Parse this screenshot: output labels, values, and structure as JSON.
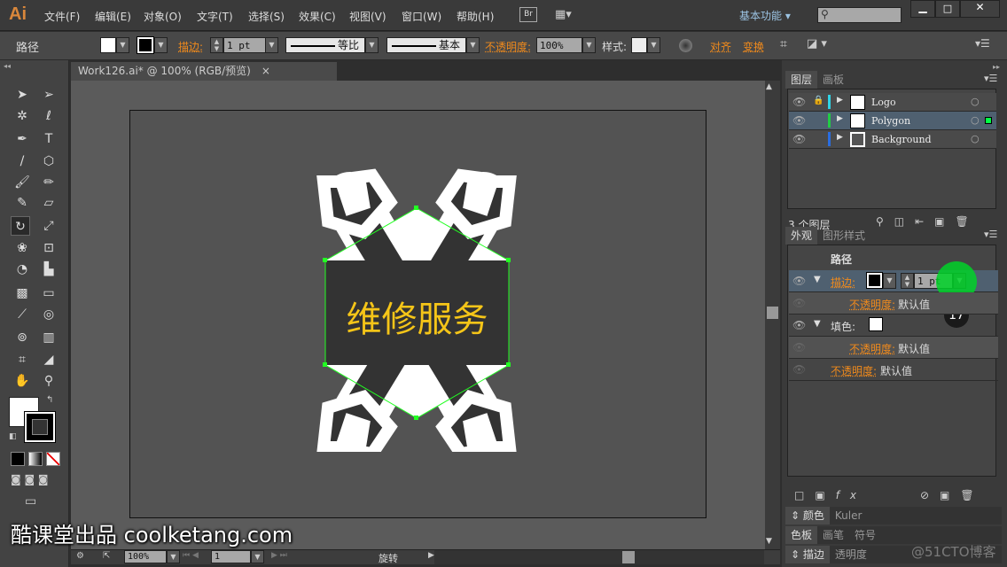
{
  "app": {
    "logo": "Ai",
    "menus": [
      "文件(F)",
      "编辑(E)",
      "对象(O)",
      "文字(T)",
      "选择(S)",
      "效果(C)",
      "视图(V)",
      "窗口(W)",
      "帮助(H)"
    ],
    "bridge": "Br",
    "workspace": "基本功能"
  },
  "control": {
    "object_type": "路径",
    "stroke_label": "描边:",
    "stroke_weight": "1 pt",
    "profile_label": "等比",
    "brush_label": "基本",
    "opacity_label": "不透明度:",
    "opacity_value": "100%",
    "style_label": "样式:",
    "align_label": "对齐",
    "transform_label": "变换"
  },
  "document": {
    "tab_title": "Work126.ai* @ 100% (RGB/预览)",
    "close": "×",
    "artwork_text": "维修服务",
    "text_color": "#f5c518"
  },
  "status": {
    "zoom": "100%",
    "artboard": "1",
    "tool": "旋转"
  },
  "layers_panel": {
    "tabs": [
      "图层",
      "画板"
    ],
    "layers": [
      {
        "name": "Logo",
        "color": "#2fd4e6",
        "locked": true
      },
      {
        "name": "Polygon",
        "color": "#22cc44",
        "selected": true
      },
      {
        "name": "Background",
        "color": "#2a6de0"
      }
    ],
    "count": "3 个图层"
  },
  "appearance_panel": {
    "tabs": [
      "外观",
      "图形样式"
    ],
    "title": "路径",
    "stroke_label": "描边:",
    "stroke_weight": "1 pt",
    "opacity_label": "不透明度:",
    "opacity_value": "默认值",
    "fill_label": "填色:",
    "step_badge": "17"
  },
  "bottom_panels": [
    {
      "tabs": [
        "颜色",
        "Kuler"
      ]
    },
    {
      "tabs": [
        "色板",
        "画笔",
        "符号"
      ]
    },
    {
      "tabs": [
        "描边",
        "透明度"
      ]
    }
  ],
  "watermark": "酷课堂出品 coolketang.com",
  "corner_watermark": "@51CTO博客"
}
